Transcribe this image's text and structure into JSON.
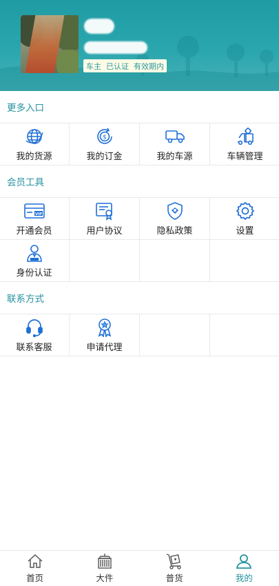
{
  "profile": {
    "badges": [
      "车主",
      "已认证",
      "有效期内"
    ]
  },
  "sections": [
    {
      "title": "更多入口",
      "items": [
        {
          "label": "我的货源",
          "icon": "globe-icon"
        },
        {
          "label": "我的订金",
          "icon": "dollar-coin-icon"
        },
        {
          "label": "我的车源",
          "icon": "truck-icon"
        },
        {
          "label": "车辆管理",
          "icon": "truck-gear-icon"
        }
      ]
    },
    {
      "title": "会员工具",
      "items": [
        {
          "label": "开通会员",
          "icon": "vip-card-icon"
        },
        {
          "label": "用户协议",
          "icon": "certificate-icon"
        },
        {
          "label": "隐私政策",
          "icon": "shield-icon"
        },
        {
          "label": "设置",
          "icon": "gear-icon"
        },
        {
          "label": "身份认证",
          "icon": "id-person-icon"
        }
      ]
    },
    {
      "title": "联系方式",
      "items": [
        {
          "label": "联系客服",
          "icon": "headset-icon"
        },
        {
          "label": "申请代理",
          "icon": "medal-icon"
        }
      ]
    }
  ],
  "tabbar": {
    "items": [
      {
        "label": "首页",
        "icon": "home-icon"
      },
      {
        "label": "大件",
        "icon": "container-icon"
      },
      {
        "label": "普货",
        "icon": "hand-truck-icon"
      },
      {
        "label": "我的",
        "icon": "user-icon",
        "active": true
      }
    ]
  },
  "colors": {
    "header": "#1f9ba3",
    "accent": "#2592a0",
    "icon_blue": "#1f6fd6"
  }
}
